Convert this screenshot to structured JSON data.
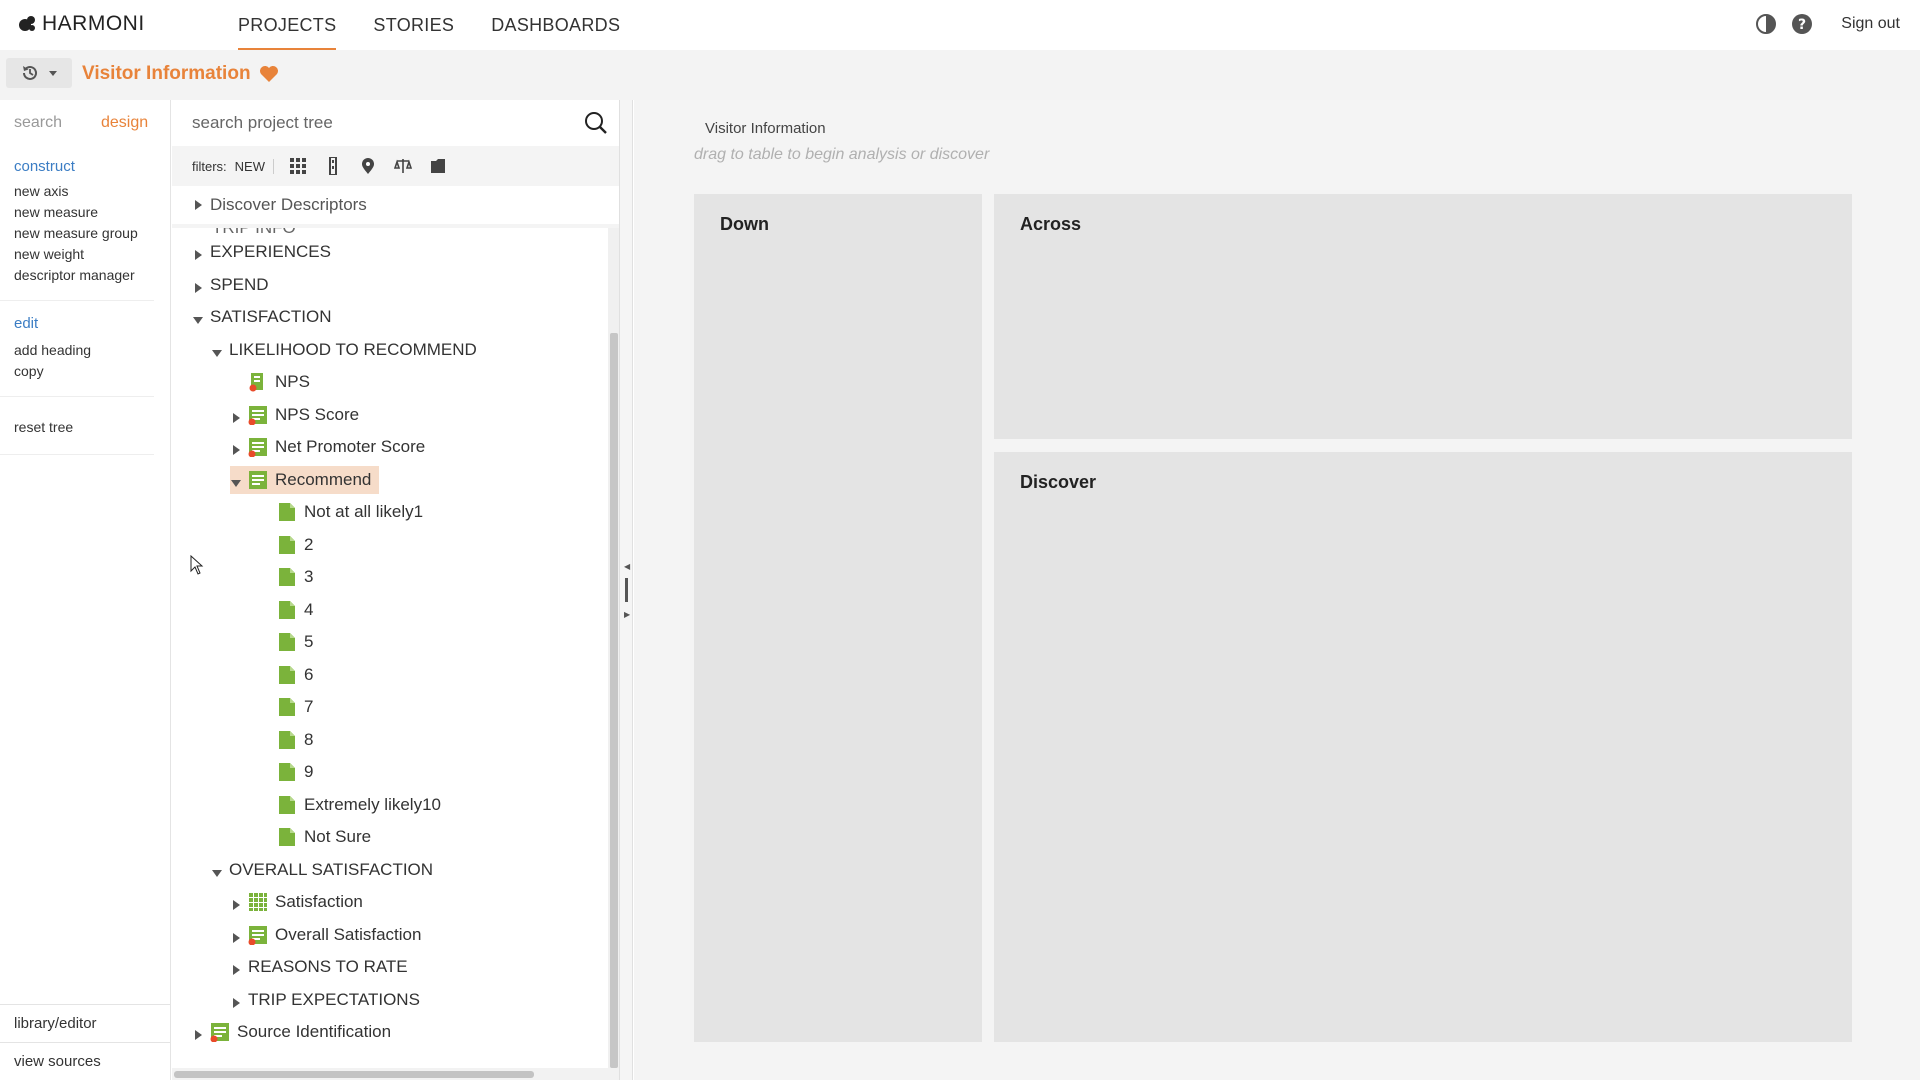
{
  "app": {
    "brand": "HARMONI",
    "nav": [
      "PROJECTS",
      "STORIES",
      "DASHBOARDS"
    ],
    "active_nav": "PROJECTS",
    "sign_out": "Sign out",
    "icons": {
      "theme": "contrast-icon",
      "help": "help-icon"
    }
  },
  "titlebar": {
    "project_title": "Visitor Information",
    "history_icon": "history-icon"
  },
  "sidebar": {
    "tabs": [
      "search",
      "design"
    ],
    "active_tab": "design",
    "groups": [
      {
        "heading": "construct",
        "items": [
          "new axis",
          "new measure",
          "new measure group",
          "new weight",
          "descriptor manager"
        ]
      },
      {
        "heading": "edit",
        "items": [
          "add heading",
          "copy"
        ]
      },
      {
        "heading": "",
        "items": [
          "reset tree"
        ]
      }
    ],
    "bottom": [
      "library/editor",
      "view sources"
    ]
  },
  "tree": {
    "search_placeholder": "search project tree",
    "filters_label": "filters:",
    "filter_new": "NEW",
    "discover": "Discover Descriptors",
    "partial_row": "TRIP INFO",
    "rows": [
      {
        "label": "EXPERIENCES",
        "caret": "right",
        "icon": ""
      },
      {
        "label": "SPEND",
        "caret": "right",
        "icon": ""
      },
      {
        "label": "SATISFACTION",
        "caret": "down",
        "icon": ""
      },
      {
        "label": "LIKELIHOOD TO RECOMMEND",
        "caret": "down",
        "icon": ""
      },
      {
        "label": "NPS",
        "caret": "",
        "icon": "nps-measure-icon"
      },
      {
        "label": "NPS Score",
        "caret": "right",
        "icon": "measure-list-icon"
      },
      {
        "label": "Net Promoter Score",
        "caret": "right",
        "icon": "measure-list-icon"
      },
      {
        "label": "Recommend",
        "caret": "down",
        "icon": "descriptor-list-icon",
        "selected": true
      },
      {
        "label": "Not at all likely1",
        "caret": "",
        "icon": "value-icon"
      },
      {
        "label": "2",
        "caret": "",
        "icon": "value-icon"
      },
      {
        "label": "3",
        "caret": "",
        "icon": "value-icon"
      },
      {
        "label": "4",
        "caret": "",
        "icon": "value-icon"
      },
      {
        "label": "5",
        "caret": "",
        "icon": "value-icon"
      },
      {
        "label": "6",
        "caret": "",
        "icon": "value-icon"
      },
      {
        "label": "7",
        "caret": "",
        "icon": "value-icon"
      },
      {
        "label": "8",
        "caret": "",
        "icon": "value-icon"
      },
      {
        "label": "9",
        "caret": "",
        "icon": "value-icon"
      },
      {
        "label": "Extremely likely10",
        "caret": "",
        "icon": "value-icon"
      },
      {
        "label": "Not Sure",
        "caret": "",
        "icon": "value-icon"
      },
      {
        "label": "OVERALL SATISFACTION",
        "caret": "down",
        "icon": ""
      },
      {
        "label": "Satisfaction",
        "caret": "right",
        "icon": "grid-icon"
      },
      {
        "label": "Overall Satisfaction",
        "caret": "right",
        "icon": "measure-list-icon"
      },
      {
        "label": "REASONS TO RATE",
        "caret": "right",
        "icon": ""
      },
      {
        "label": "TRIP EXPECTATIONS",
        "caret": "right",
        "icon": ""
      },
      {
        "label": "Source Identification",
        "caret": "right",
        "icon": "measure-list-icon"
      }
    ]
  },
  "main": {
    "title": "Visitor Information",
    "hint": "drag to table to begin analysis or discover",
    "zones": [
      "Down",
      "Across",
      "Discover"
    ]
  },
  "colors": {
    "accent": "#e8833a",
    "link": "#3b7dc4",
    "leaf_green": "#7bb33b",
    "selected_bg": "#f6dcc9"
  }
}
